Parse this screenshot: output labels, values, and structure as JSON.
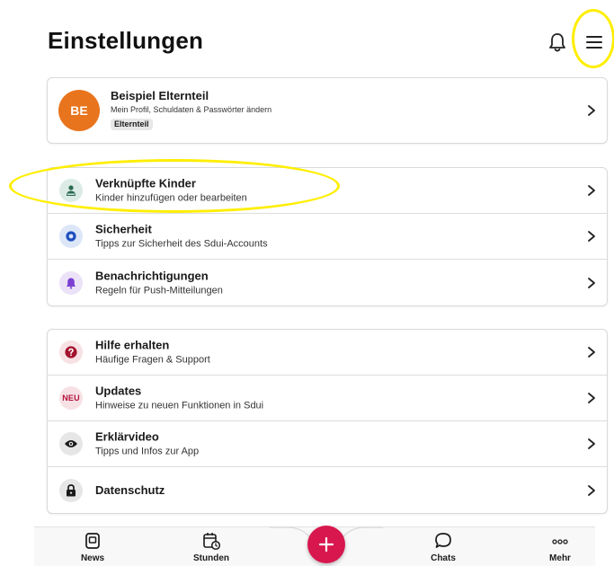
{
  "header": {
    "title": "Einstellungen",
    "icons": [
      "bell-icon",
      "menu-icon"
    ]
  },
  "profile": {
    "initials": "BE",
    "name": "Beispiel Elternteil",
    "subtitle": "Mein Profil, Schuldaten & Passwörter ändern",
    "role": "Elternteil",
    "avatar_color": "#e8741d"
  },
  "group1": [
    {
      "title": "Verknüpfte Kinder",
      "subtitle": "Kinder hinzufügen oder bearbeiten",
      "icon": "child-icon",
      "icon_bg": "#dcebe5",
      "icon_color": "#2a6b52"
    },
    {
      "title": "Sicherheit",
      "subtitle": "Tipps zur Sicherheit des Sdui-Accounts",
      "icon": "shield-icon",
      "icon_bg": "#dce6f7",
      "icon_color": "#1f4fbf"
    },
    {
      "title": "Benachrichtigungen",
      "subtitle": "Regeln für Push-Mitteilungen",
      "icon": "bell-icon",
      "icon_bg": "#ece2f8",
      "icon_color": "#7a3fd1"
    }
  ],
  "group2": [
    {
      "title": "Hilfe erhalten",
      "subtitle": "Häufige Fragen & Support",
      "icon": "help-icon",
      "icon_bg": "#f7e1e5",
      "icon_color": "#a3122e"
    },
    {
      "title": "Updates",
      "subtitle": "Hinweise zu neuen Funktionen in Sdui",
      "icon_text": "NEU",
      "icon_bg": "#f7e1e5"
    },
    {
      "title": "Erklärvideo",
      "subtitle": "Tipps und Infos zur App",
      "icon": "eye-icon",
      "icon_bg": "#e6e6e6",
      "icon_color": "#1a1a1a"
    },
    {
      "title": "Datenschutz",
      "subtitle": "",
      "icon": "lock-icon",
      "icon_bg": "#e6e6e6",
      "icon_color": "#1a1a1a"
    }
  ],
  "tabbar": {
    "tabs": [
      {
        "label": "News",
        "icon": "news-icon"
      },
      {
        "label": "Stunden",
        "icon": "calendar-clock-icon"
      },
      {
        "label": "Chats",
        "icon": "chat-bubble-icon"
      },
      {
        "label": "Mehr",
        "icon": "more-dots-icon"
      }
    ],
    "fab_icon": "plus-icon",
    "accent": "#d8174f"
  },
  "highlight_color": "#ffee00"
}
